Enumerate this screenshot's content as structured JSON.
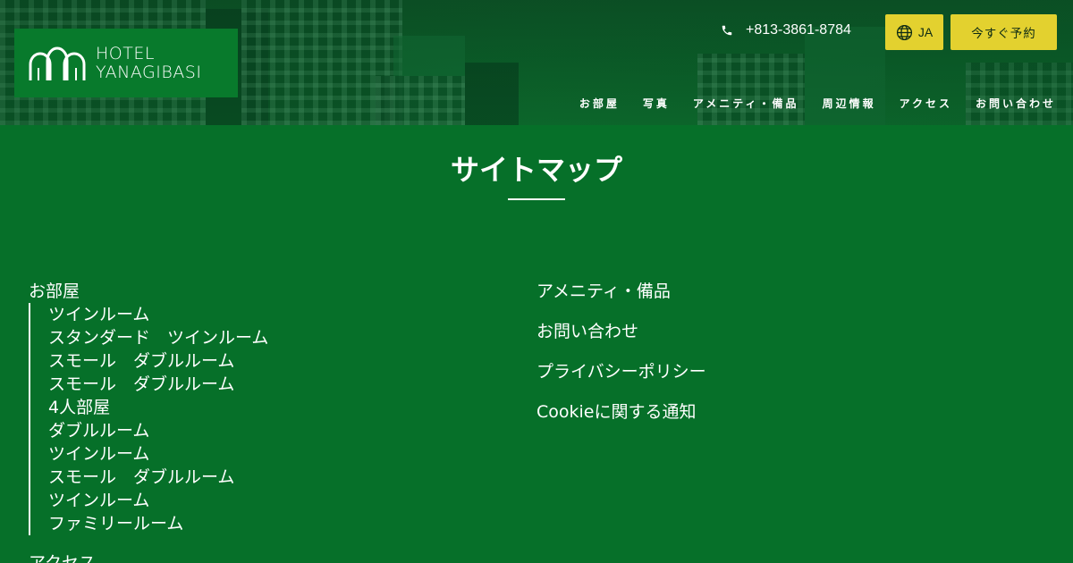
{
  "header": {
    "logo": {
      "line1": "HOTEL",
      "line2": "YANAGIBASI"
    },
    "phone": "+813-3861-8784",
    "language": "JA",
    "reserve_label": "今すぐ予約",
    "nav": [
      {
        "label": "お部屋"
      },
      {
        "label": "写真"
      },
      {
        "label": "アメニティ・備品"
      },
      {
        "label": "周辺情報"
      },
      {
        "label": "アクセス"
      },
      {
        "label": "お問い合わせ"
      }
    ]
  },
  "main": {
    "title": "サイトマップ",
    "left": {
      "rooms_label": "お部屋",
      "rooms": [
        "ツインルーム",
        "スタンダード　ツインルーム",
        "スモール　ダブルルーム",
        "スモール　ダブルルーム",
        "4人部屋",
        "ダブルルーム",
        "ツインルーム",
        "スモール　ダブルルーム",
        "ツインルーム",
        "ファミリールーム"
      ],
      "access_label": "アクセス"
    },
    "right": [
      "アメニティ・備品",
      "お問い合わせ",
      "プライバシーポリシー",
      "Cookieに関する通知"
    ]
  },
  "colors": {
    "background": "#067029",
    "header_dark": "#0b5a27",
    "logo_bg": "#087a2c",
    "button_yellow": "#e3d12f",
    "text": "#ffffff"
  },
  "icons": [
    "phone-icon",
    "globe-icon",
    "hotel-logo-arches-icon"
  ]
}
